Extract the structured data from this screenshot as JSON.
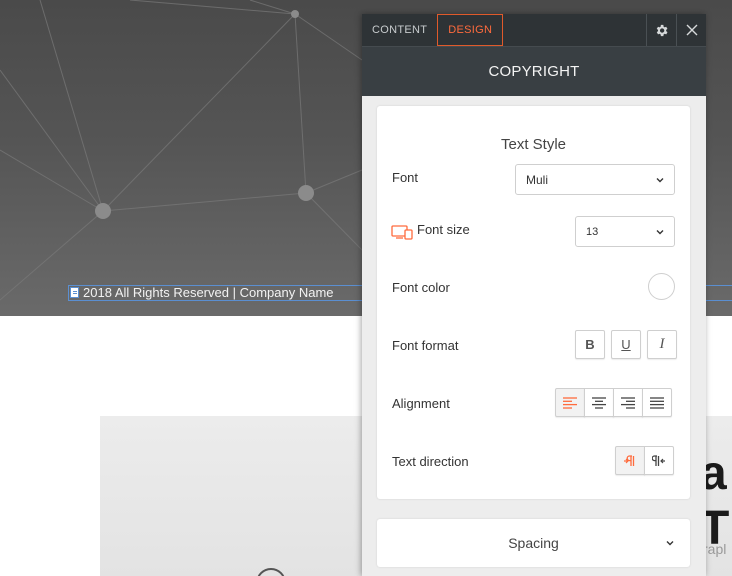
{
  "panel": {
    "tabs": [
      {
        "label": "CONTENT"
      },
      {
        "label": "DESIGN",
        "active": true
      }
    ],
    "icons": {
      "settings": "gear-icon",
      "close": "close-icon"
    },
    "title": "COPYRIGHT",
    "text_style": {
      "heading": "Text Style",
      "font": {
        "label": "Font",
        "value": "Muli"
      },
      "font_size": {
        "label": "Font size",
        "value": "13",
        "icon": "responsive-devices-icon"
      },
      "font_color": {
        "label": "Font color",
        "value": "#ffffff"
      },
      "font_format": {
        "label": "Font format",
        "bold": "B",
        "underline": "U",
        "italic": "I"
      },
      "alignment": {
        "label": "Alignment",
        "options": [
          "left",
          "center",
          "right",
          "justify"
        ],
        "selected": "left"
      },
      "text_direction": {
        "label": "Text direction",
        "options": [
          "ltr",
          "rtl"
        ],
        "selected": "ltr"
      }
    },
    "spacing": {
      "label": "Spacing"
    }
  },
  "page": {
    "copyright_text": "2018  All Rights Reserved | Company Name",
    "heading_fragment": "a T",
    "paragraph_fragment": "rapl"
  },
  "colors": {
    "accent": "#ff6b3d",
    "panel_dark": "#2e3336",
    "panel_title": "#393f43",
    "selection_outline": "#5b8fd1"
  }
}
